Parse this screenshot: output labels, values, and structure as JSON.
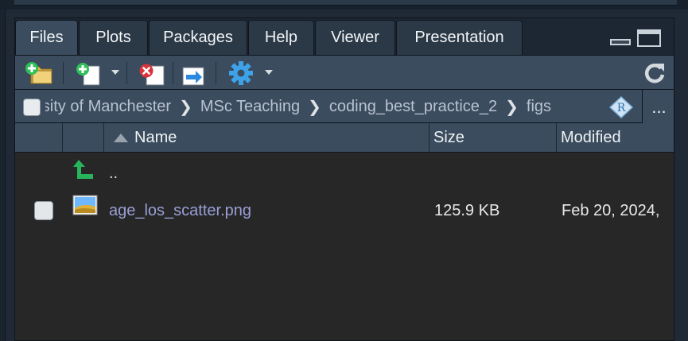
{
  "tabs": [
    {
      "label": "Files",
      "active": true
    },
    {
      "label": "Plots"
    },
    {
      "label": "Packages"
    },
    {
      "label": "Help"
    },
    {
      "label": "Viewer"
    },
    {
      "label": "Presentation"
    }
  ],
  "toolbar": {
    "buttons": [
      "new-folder-icon",
      "new-blank-file-icon",
      "delete-icon",
      "rename-icon",
      "gear-icon",
      "refresh-icon"
    ]
  },
  "breadcrumb": {
    "items": [
      "ersity of Manchester",
      "MSc Teaching",
      "coding_best_practice_2",
      "figs"
    ],
    "more": "..."
  },
  "columns": {
    "name": "Name",
    "size": "Size",
    "modified": "Modified"
  },
  "files": [
    {
      "name": "..",
      "type": "parent"
    },
    {
      "name": "age_los_scatter.png",
      "size": "125.9 KB",
      "modified": "Feb 20, 2024,",
      "type": "image"
    }
  ],
  "colors": {
    "accent_link": "#9a9fd6",
    "tab_active": "#3a4c5e",
    "pane_bg": "#272727"
  }
}
